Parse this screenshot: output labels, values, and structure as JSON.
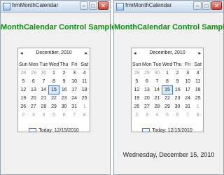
{
  "windows": [
    {
      "title": "frmMonthCalendar",
      "heading": "MonthCalendar Control Sample",
      "calendar": {
        "month_label": "December, 2010",
        "prev_arrow": "◂",
        "next_arrow": "▸",
        "weekdays": [
          "Sun",
          "Mon",
          "Tue",
          "Wed",
          "Thu",
          "Fri",
          "Sat"
        ],
        "weeks": [
          [
            "28",
            "29",
            "30",
            "1",
            "2",
            "3",
            "4"
          ],
          [
            "5",
            "6",
            "7",
            "8",
            "9",
            "10",
            "11"
          ],
          [
            "12",
            "13",
            "14",
            "15",
            "16",
            "17",
            "18"
          ],
          [
            "19",
            "20",
            "21",
            "22",
            "23",
            "24",
            "25"
          ],
          [
            "26",
            "27",
            "28",
            "29",
            "30",
            "31",
            "1"
          ],
          [
            "2",
            "3",
            "4",
            "5",
            "6",
            "7",
            "8"
          ]
        ],
        "selected": "15",
        "today_label": "Today: 12/15/2010"
      },
      "selected_date_text": ""
    },
    {
      "title": "frmMonthCalendar",
      "heading": "MonthCalendar Control Sample",
      "calendar": {
        "month_label": "December, 2010",
        "prev_arrow": "◂",
        "next_arrow": "▸",
        "weekdays": [
          "Sun",
          "Mon",
          "Tue",
          "Wed",
          "Thu",
          "Fri",
          "Sat"
        ],
        "weeks": [
          [
            "28",
            "29",
            "30",
            "1",
            "2",
            "3",
            "4"
          ],
          [
            "5",
            "6",
            "7",
            "8",
            "9",
            "10",
            "11"
          ],
          [
            "12",
            "13",
            "14",
            "15",
            "16",
            "17",
            "18"
          ],
          [
            "19",
            "20",
            "21",
            "22",
            "23",
            "24",
            "25"
          ],
          [
            "26",
            "27",
            "28",
            "29",
            "30",
            "31",
            "1"
          ],
          [
            "2",
            "3",
            "4",
            "5",
            "6",
            "7",
            "8"
          ]
        ],
        "selected": "15",
        "today_label": "Today: 12/15/2010"
      },
      "selected_date_text": "Wednesday, December 15, 2010"
    }
  ],
  "icons": {
    "minimize": "minimize-icon",
    "maximize": "maximize-icon",
    "close": "close-icon",
    "minimize_glyph": "–",
    "maximize_glyph": "□",
    "close_glyph": "✕"
  },
  "colors": {
    "heading": "#138a13",
    "selected_day_border": "#3c7fd0",
    "muted_day": "#9a9a9a"
  }
}
